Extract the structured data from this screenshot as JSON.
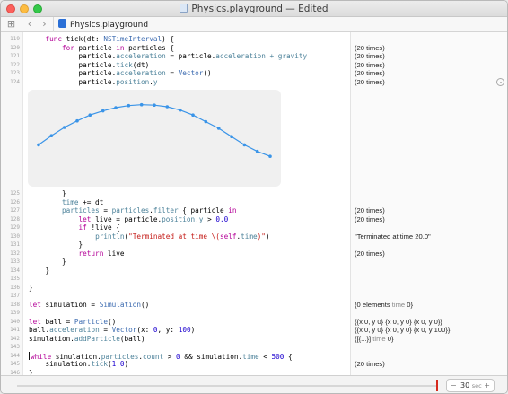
{
  "window": {
    "title": "Physics.playground — Edited"
  },
  "jumpbar": {
    "grid_glyph": "⊞",
    "back_glyph": "‹",
    "forward_glyph": "›",
    "file_name": "Physics.playground"
  },
  "plot_points": [
    [
      0.0,
      42
    ],
    [
      1.0,
      53
    ],
    [
      2.0,
      63
    ],
    [
      3.0,
      71
    ],
    [
      4.0,
      78
    ],
    [
      5.0,
      83
    ],
    [
      6.0,
      87
    ],
    [
      7.0,
      89.5
    ],
    [
      8.0,
      90.5
    ],
    [
      9.0,
      90
    ],
    [
      10.0,
      88
    ],
    [
      11.0,
      84
    ],
    [
      12.0,
      78
    ],
    [
      13.0,
      70
    ],
    [
      14.0,
      62
    ],
    [
      15.0,
      52
    ],
    [
      16.0,
      42
    ],
    [
      17.0,
      34
    ],
    [
      18.0,
      28
    ]
  ],
  "results": {
    "r124": "(20 times)",
    "r127": "(20 times)",
    "r128": "(20 times)",
    "r131": "\"Terminated at time 20.0\"",
    "r133": "(20 times)",
    "r138a": "{0 elements ",
    "r138b": "time",
    "r138c": " 0}",
    "r140": "{{x 0, y 0} {x 0, y 0} {x 0, y 0}}",
    "r141": "{{x 0, y 0} {x 0, y 0} {x 0, y 100}}",
    "r142a": "{[{...}] ",
    "r142b": "time",
    "r142c": " 0}",
    "r145": "(20 times)",
    "r120": "(20 times)",
    "r121": "(20 times)",
    "r122": "(20 times)",
    "r123": "(20 times)"
  },
  "stepper": {
    "minus": "−",
    "value": "30",
    "unit": "sec",
    "plus": "+"
  },
  "colors": {
    "accent": "#3a94e8",
    "keyword": "#b40097",
    "type": "#3c6bb0",
    "string": "#c41a16",
    "number": "#1c00cf"
  }
}
